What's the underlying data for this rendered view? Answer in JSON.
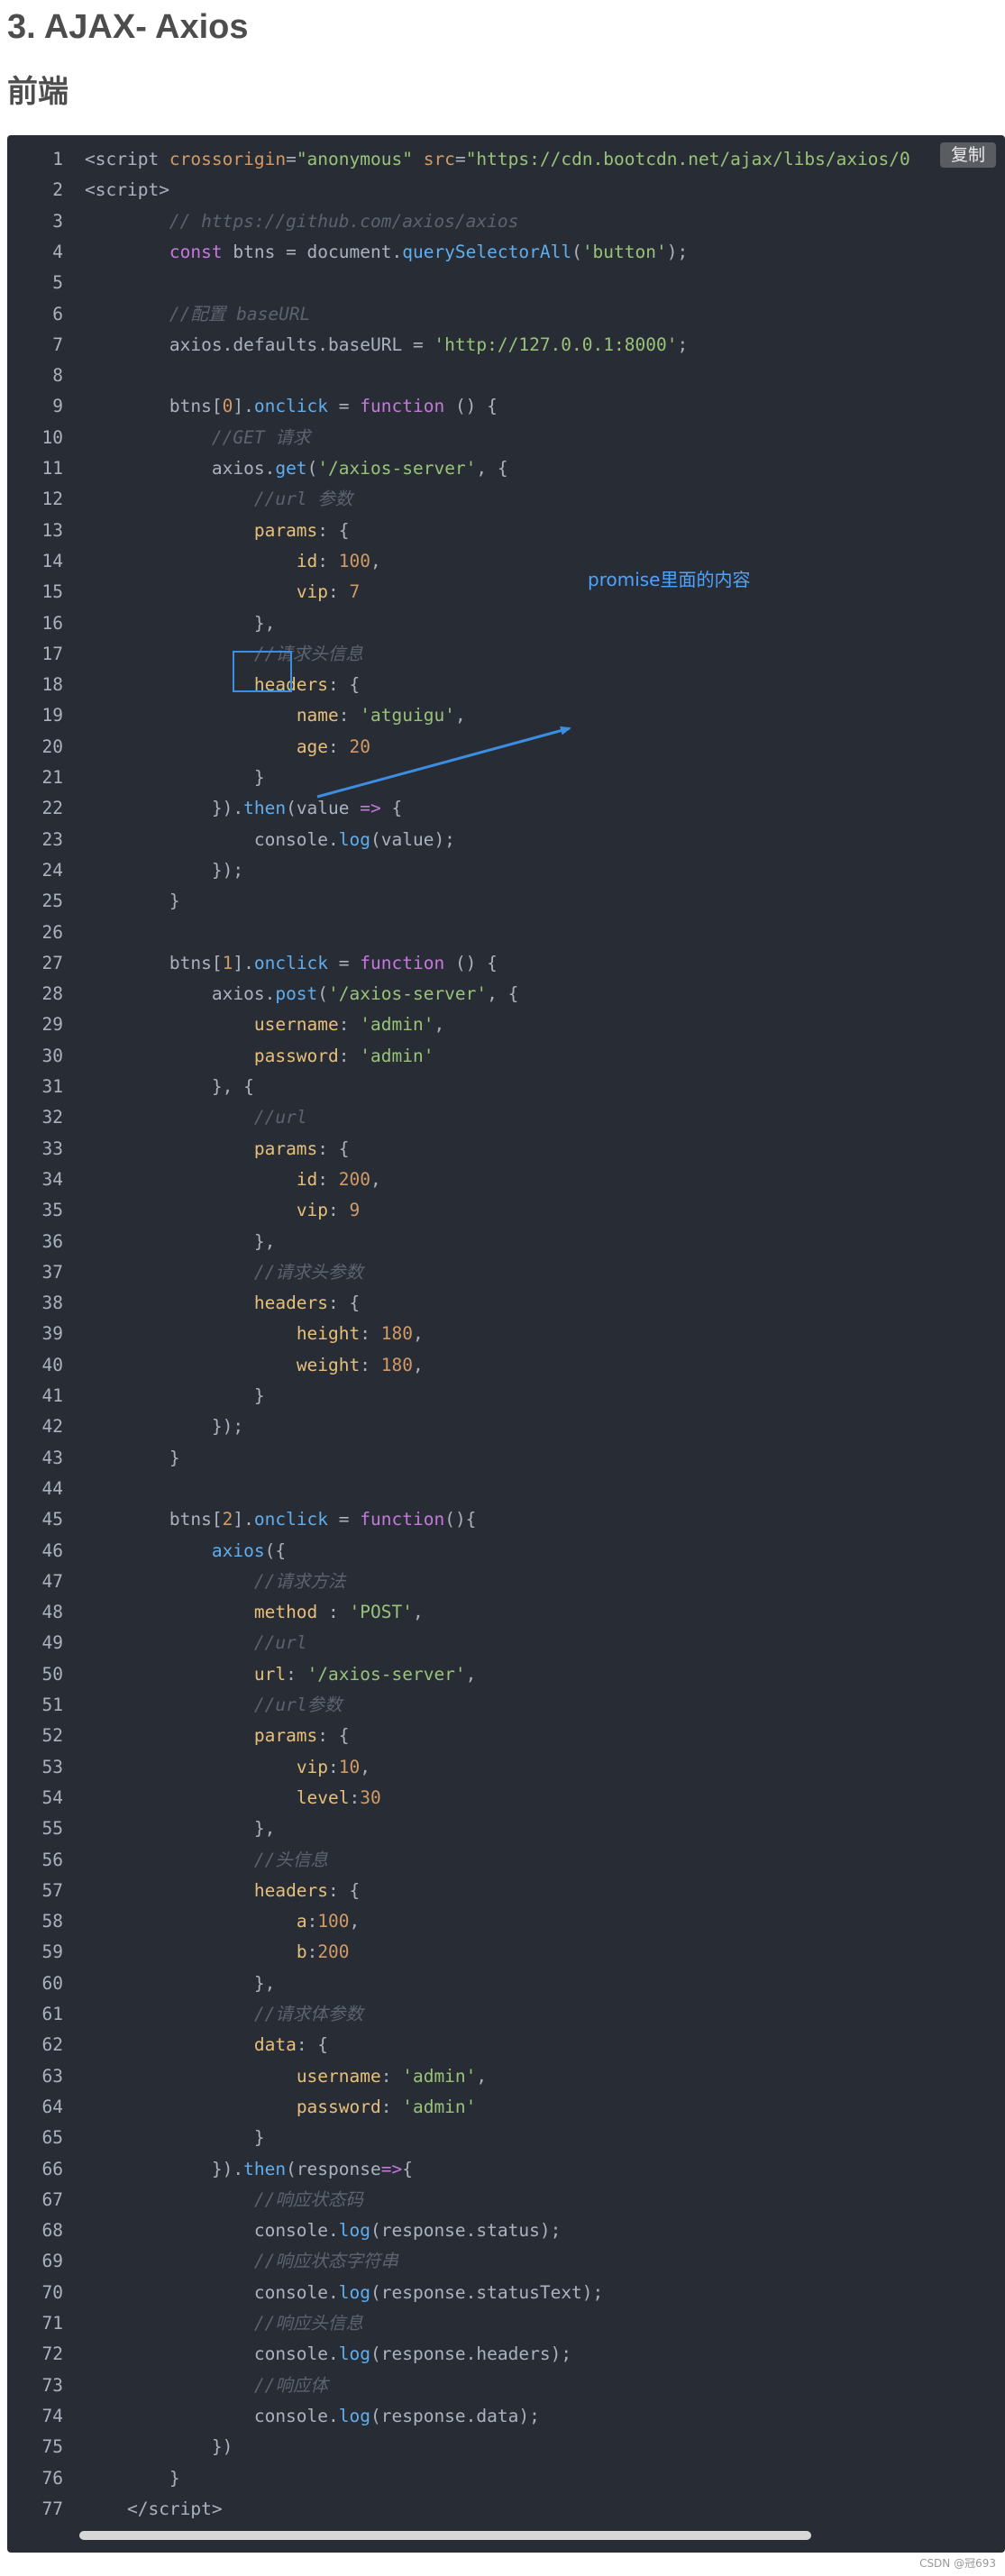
{
  "article": {
    "heading": "3. AJAX- Axios",
    "subheading": "前端",
    "copy_label": "复制",
    "annotation": "promise里面的内容",
    "watermark": "CSDN @冠693"
  },
  "code_lines": [
    [
      [
        "tag",
        "<script "
      ],
      [
        "attr",
        "crossorigin"
      ],
      [
        "pl",
        "="
      ],
      [
        "str",
        "\"anonymous\""
      ],
      [
        "pl",
        " "
      ],
      [
        "attr",
        "src"
      ],
      [
        "pl",
        "="
      ],
      [
        "str",
        "\"https://cdn.bootcdn.net/ajax/libs/axios/0"
      ]
    ],
    [
      [
        "tag",
        "<script"
      ],
      [
        "tag",
        ">"
      ]
    ],
    [
      [
        "pl",
        "        "
      ],
      [
        "com",
        "// https://github.com/axios/axios"
      ]
    ],
    [
      [
        "pl",
        "        "
      ],
      [
        "kw",
        "const"
      ],
      [
        "pl",
        " btns = document."
      ],
      [
        "fn",
        "querySelectorAll"
      ],
      [
        "pl",
        "("
      ],
      [
        "str",
        "'button'"
      ],
      [
        "pl",
        ");"
      ]
    ],
    [
      [
        "pl",
        ""
      ]
    ],
    [
      [
        "pl",
        "        "
      ],
      [
        "com",
        "//配置 baseURL"
      ]
    ],
    [
      [
        "pl",
        "        axios.defaults.baseURL = "
      ],
      [
        "str",
        "'http://127.0.0.1:8000'"
      ],
      [
        "pl",
        ";"
      ]
    ],
    [
      [
        "pl",
        ""
      ]
    ],
    [
      [
        "pl",
        "        btns["
      ],
      [
        "num",
        "0"
      ],
      [
        "pl",
        "]."
      ],
      [
        "fn",
        "onclick"
      ],
      [
        "pl",
        " = "
      ],
      [
        "kw",
        "function"
      ],
      [
        "pl",
        " () {"
      ]
    ],
    [
      [
        "pl",
        "            "
      ],
      [
        "com",
        "//GET 请求"
      ]
    ],
    [
      [
        "pl",
        "            axios."
      ],
      [
        "fn",
        "get"
      ],
      [
        "pl",
        "("
      ],
      [
        "str",
        "'/axios-server'"
      ],
      [
        "pl",
        ", {"
      ]
    ],
    [
      [
        "pl",
        "                "
      ],
      [
        "com",
        "//url 参数"
      ]
    ],
    [
      [
        "pl",
        "                "
      ],
      [
        "prop",
        "params"
      ],
      [
        "pl",
        ": {"
      ]
    ],
    [
      [
        "pl",
        "                    "
      ],
      [
        "prop",
        "id"
      ],
      [
        "pl",
        ": "
      ],
      [
        "num",
        "100"
      ],
      [
        "pl",
        ","
      ]
    ],
    [
      [
        "pl",
        "                    "
      ],
      [
        "prop",
        "vip"
      ],
      [
        "pl",
        ": "
      ],
      [
        "num",
        "7"
      ]
    ],
    [
      [
        "pl",
        "                },"
      ]
    ],
    [
      [
        "pl",
        "                "
      ],
      [
        "com",
        "//请求头信息"
      ]
    ],
    [
      [
        "pl",
        "                "
      ],
      [
        "prop",
        "headers"
      ],
      [
        "pl",
        ": {"
      ]
    ],
    [
      [
        "pl",
        "                    "
      ],
      [
        "prop",
        "name"
      ],
      [
        "pl",
        ": "
      ],
      [
        "str",
        "'atguigu'"
      ],
      [
        "pl",
        ","
      ]
    ],
    [
      [
        "pl",
        "                    "
      ],
      [
        "prop",
        "age"
      ],
      [
        "pl",
        ": "
      ],
      [
        "num",
        "20"
      ]
    ],
    [
      [
        "pl",
        "                }"
      ]
    ],
    [
      [
        "pl",
        "            })."
      ],
      [
        "fn",
        "then"
      ],
      [
        "pl",
        "(value "
      ],
      [
        "kw",
        "=>"
      ],
      [
        "pl",
        " {"
      ]
    ],
    [
      [
        "pl",
        "                console."
      ],
      [
        "fn",
        "log"
      ],
      [
        "pl",
        "(value);"
      ]
    ],
    [
      [
        "pl",
        "            });"
      ]
    ],
    [
      [
        "pl",
        "        }"
      ]
    ],
    [
      [
        "pl",
        ""
      ]
    ],
    [
      [
        "pl",
        "        btns["
      ],
      [
        "num",
        "1"
      ],
      [
        "pl",
        "]."
      ],
      [
        "fn",
        "onclick"
      ],
      [
        "pl",
        " = "
      ],
      [
        "kw",
        "function"
      ],
      [
        "pl",
        " () {"
      ]
    ],
    [
      [
        "pl",
        "            axios."
      ],
      [
        "fn",
        "post"
      ],
      [
        "pl",
        "("
      ],
      [
        "str",
        "'/axios-server'"
      ],
      [
        "pl",
        ", {"
      ]
    ],
    [
      [
        "pl",
        "                "
      ],
      [
        "prop",
        "username"
      ],
      [
        "pl",
        ": "
      ],
      [
        "str",
        "'admin'"
      ],
      [
        "pl",
        ","
      ]
    ],
    [
      [
        "pl",
        "                "
      ],
      [
        "prop",
        "password"
      ],
      [
        "pl",
        ": "
      ],
      [
        "str",
        "'admin'"
      ]
    ],
    [
      [
        "pl",
        "            }, {"
      ]
    ],
    [
      [
        "pl",
        "                "
      ],
      [
        "com",
        "//url"
      ]
    ],
    [
      [
        "pl",
        "                "
      ],
      [
        "prop",
        "params"
      ],
      [
        "pl",
        ": {"
      ]
    ],
    [
      [
        "pl",
        "                    "
      ],
      [
        "prop",
        "id"
      ],
      [
        "pl",
        ": "
      ],
      [
        "num",
        "200"
      ],
      [
        "pl",
        ","
      ]
    ],
    [
      [
        "pl",
        "                    "
      ],
      [
        "prop",
        "vip"
      ],
      [
        "pl",
        ": "
      ],
      [
        "num",
        "9"
      ]
    ],
    [
      [
        "pl",
        "                },"
      ]
    ],
    [
      [
        "pl",
        "                "
      ],
      [
        "com",
        "//请求头参数"
      ]
    ],
    [
      [
        "pl",
        "                "
      ],
      [
        "prop",
        "headers"
      ],
      [
        "pl",
        ": {"
      ]
    ],
    [
      [
        "pl",
        "                    "
      ],
      [
        "prop",
        "height"
      ],
      [
        "pl",
        ": "
      ],
      [
        "num",
        "180"
      ],
      [
        "pl",
        ","
      ]
    ],
    [
      [
        "pl",
        "                    "
      ],
      [
        "prop",
        "weight"
      ],
      [
        "pl",
        ": "
      ],
      [
        "num",
        "180"
      ],
      [
        "pl",
        ","
      ]
    ],
    [
      [
        "pl",
        "                }"
      ]
    ],
    [
      [
        "pl",
        "            });"
      ]
    ],
    [
      [
        "pl",
        "        }"
      ]
    ],
    [
      [
        "pl",
        ""
      ]
    ],
    [
      [
        "pl",
        "        btns["
      ],
      [
        "num",
        "2"
      ],
      [
        "pl",
        "]."
      ],
      [
        "fn",
        "onclick"
      ],
      [
        "pl",
        " = "
      ],
      [
        "kw",
        "function"
      ],
      [
        "pl",
        "(){"
      ]
    ],
    [
      [
        "pl",
        "            "
      ],
      [
        "fn",
        "axios"
      ],
      [
        "pl",
        "({"
      ]
    ],
    [
      [
        "pl",
        "                "
      ],
      [
        "com",
        "//请求方法"
      ]
    ],
    [
      [
        "pl",
        "                "
      ],
      [
        "prop",
        "method"
      ],
      [
        "pl",
        " : "
      ],
      [
        "str",
        "'POST'"
      ],
      [
        "pl",
        ","
      ]
    ],
    [
      [
        "pl",
        "                "
      ],
      [
        "com",
        "//url"
      ]
    ],
    [
      [
        "pl",
        "                "
      ],
      [
        "prop",
        "url"
      ],
      [
        "pl",
        ": "
      ],
      [
        "str",
        "'/axios-server'"
      ],
      [
        "pl",
        ","
      ]
    ],
    [
      [
        "pl",
        "                "
      ],
      [
        "com",
        "//url参数"
      ]
    ],
    [
      [
        "pl",
        "                "
      ],
      [
        "prop",
        "params"
      ],
      [
        "pl",
        ": {"
      ]
    ],
    [
      [
        "pl",
        "                    "
      ],
      [
        "prop",
        "vip"
      ],
      [
        "pl",
        ":"
      ],
      [
        "num",
        "10"
      ],
      [
        "pl",
        ","
      ]
    ],
    [
      [
        "pl",
        "                    "
      ],
      [
        "prop",
        "level"
      ],
      [
        "pl",
        ":"
      ],
      [
        "num",
        "30"
      ]
    ],
    [
      [
        "pl",
        "                },"
      ]
    ],
    [
      [
        "pl",
        "                "
      ],
      [
        "com",
        "//头信息"
      ]
    ],
    [
      [
        "pl",
        "                "
      ],
      [
        "prop",
        "headers"
      ],
      [
        "pl",
        ": {"
      ]
    ],
    [
      [
        "pl",
        "                    "
      ],
      [
        "prop",
        "a"
      ],
      [
        "pl",
        ":"
      ],
      [
        "num",
        "100"
      ],
      [
        "pl",
        ","
      ]
    ],
    [
      [
        "pl",
        "                    "
      ],
      [
        "prop",
        "b"
      ],
      [
        "pl",
        ":"
      ],
      [
        "num",
        "200"
      ]
    ],
    [
      [
        "pl",
        "                },"
      ]
    ],
    [
      [
        "pl",
        "                "
      ],
      [
        "com",
        "//请求体参数"
      ]
    ],
    [
      [
        "pl",
        "                "
      ],
      [
        "prop",
        "data"
      ],
      [
        "pl",
        ": {"
      ]
    ],
    [
      [
        "pl",
        "                    "
      ],
      [
        "prop",
        "username"
      ],
      [
        "pl",
        ": "
      ],
      [
        "str",
        "'admin'"
      ],
      [
        "pl",
        ","
      ]
    ],
    [
      [
        "pl",
        "                    "
      ],
      [
        "prop",
        "password"
      ],
      [
        "pl",
        ": "
      ],
      [
        "str",
        "'admin'"
      ]
    ],
    [
      [
        "pl",
        "                }"
      ]
    ],
    [
      [
        "pl",
        "            })."
      ],
      [
        "fn",
        "then"
      ],
      [
        "pl",
        "(response"
      ],
      [
        "kw",
        "=>"
      ],
      [
        "pl",
        "{"
      ]
    ],
    [
      [
        "pl",
        "                "
      ],
      [
        "com",
        "//响应状态码"
      ]
    ],
    [
      [
        "pl",
        "                console."
      ],
      [
        "fn",
        "log"
      ],
      [
        "pl",
        "(response.status);"
      ]
    ],
    [
      [
        "pl",
        "                "
      ],
      [
        "com",
        "//响应状态字符串"
      ]
    ],
    [
      [
        "pl",
        "                console."
      ],
      [
        "fn",
        "log"
      ],
      [
        "pl",
        "(response.statusText);"
      ]
    ],
    [
      [
        "pl",
        "                "
      ],
      [
        "com",
        "//响应头信息"
      ]
    ],
    [
      [
        "pl",
        "                console."
      ],
      [
        "fn",
        "log"
      ],
      [
        "pl",
        "(response.headers);"
      ]
    ],
    [
      [
        "pl",
        "                "
      ],
      [
        "com",
        "//响应体"
      ]
    ],
    [
      [
        "pl",
        "                console."
      ],
      [
        "fn",
        "log"
      ],
      [
        "pl",
        "(response.data);"
      ]
    ],
    [
      [
        "pl",
        "            })"
      ]
    ],
    [
      [
        "pl",
        "        }"
      ]
    ],
    [
      [
        "pl",
        "    "
      ],
      [
        "tag",
        "</script"
      ],
      [
        "tag",
        ">"
      ]
    ]
  ],
  "colors": {
    "code_background": "#282c34",
    "comment": "#5c6370",
    "string": "#98c379",
    "keyword": "#c678dd",
    "function": "#61aeee",
    "number": "#d19a66",
    "property": "#e6c07b",
    "annotation": "#3b8ee2"
  }
}
